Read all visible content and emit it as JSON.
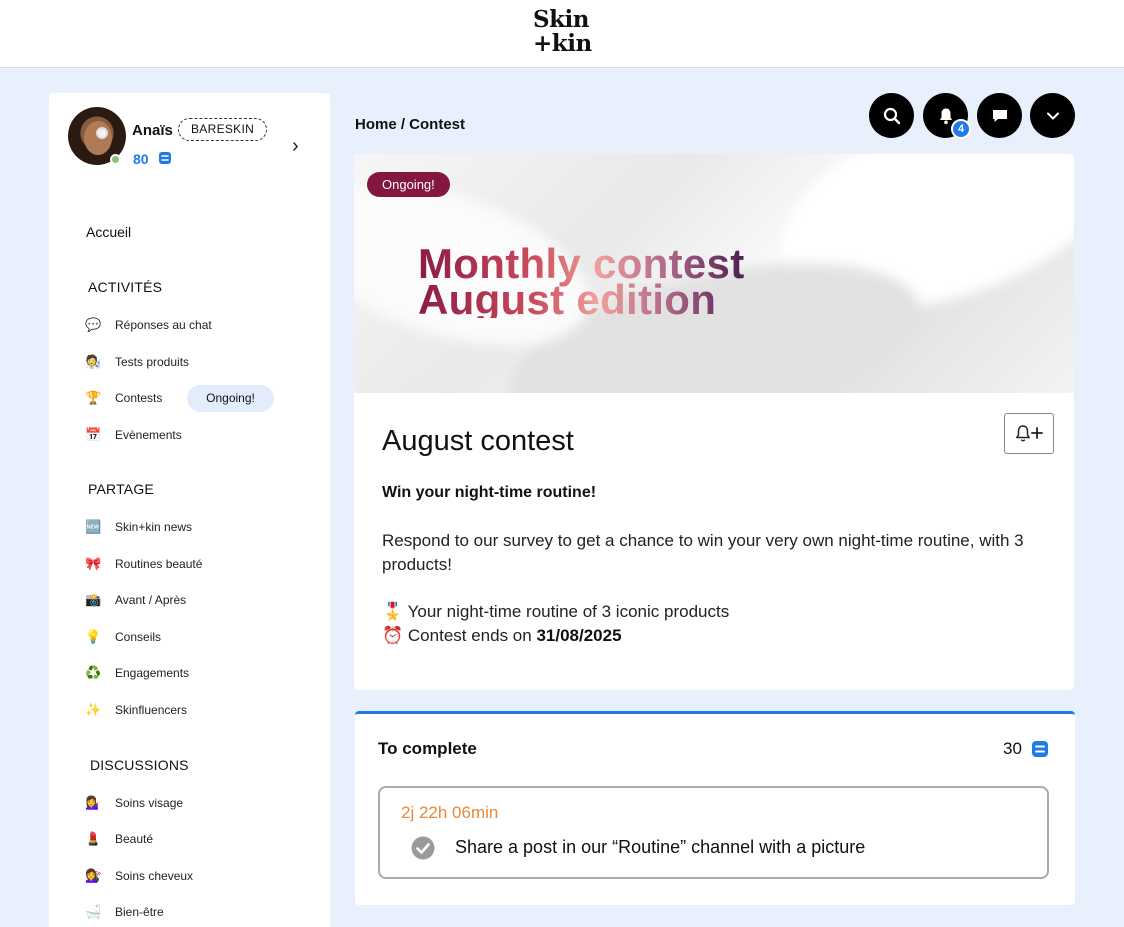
{
  "brand": {
    "logo_line1": "Skin",
    "logo_line2": "+kin"
  },
  "user": {
    "name": "Anaïs",
    "tier": "BARESKIN",
    "points": "80"
  },
  "nav": {
    "home": "Accueil",
    "sections": [
      {
        "title": "ACTIVITÉS",
        "items": [
          {
            "icon": "speech-bubble-icon",
            "glyph": "💬",
            "label": "Réponses au chat"
          },
          {
            "icon": "scientist-icon",
            "glyph": "🧑‍🔬",
            "label": "Tests produits"
          },
          {
            "icon": "trophy-icon",
            "glyph": "🏆",
            "label": "Contests",
            "badge": "Ongoing!"
          },
          {
            "icon": "calendar-icon",
            "glyph": "📅",
            "label": "Evènements"
          }
        ]
      },
      {
        "title": "PARTAGE",
        "items": [
          {
            "icon": "new-icon",
            "glyph": "🆕",
            "label": "Skin+kin news"
          },
          {
            "icon": "ribbon-icon",
            "glyph": "🎀",
            "label": "Routines beauté"
          },
          {
            "icon": "camera-icon",
            "glyph": "📸",
            "label": "Avant / Après"
          },
          {
            "icon": "lightbulb-icon",
            "glyph": "💡",
            "label": "Conseils"
          },
          {
            "icon": "recycle-icon",
            "glyph": "♻️",
            "label": "Engagements"
          },
          {
            "icon": "sparkles-icon",
            "glyph": "✨",
            "label": "Skinfluencers"
          }
        ]
      },
      {
        "title": "DISCUSSIONS",
        "items": [
          {
            "icon": "woman-tipping-hand-icon",
            "glyph": "💁‍♀️",
            "label": "Soins visage"
          },
          {
            "icon": "lipstick-icon",
            "glyph": "💄",
            "label": "Beauté"
          },
          {
            "icon": "woman-haircut-icon",
            "glyph": "💇‍♀️",
            "label": "Soins cheveux"
          },
          {
            "icon": "bathtub-icon",
            "glyph": "🛁",
            "label": "Bien-être"
          }
        ]
      }
    ]
  },
  "header": {
    "breadcrumb": "Home / Contest",
    "notification_count": "4"
  },
  "contest": {
    "status_badge": "Ongoing!",
    "banner_line1": "Monthly contest",
    "banner_line2": "August edition",
    "title": "August contest",
    "subtitle": "Win your night-time routine!",
    "description": "Respond to our survey to get a chance to win your very own night-time routine, with 3 products!",
    "prize_glyph": "🎖️",
    "prize_text": "Your night-time routine of 3 iconic products",
    "deadline_glyph": "⏰",
    "deadline_prefix": "Contest ends on ",
    "deadline_date": "31/08/2025"
  },
  "task": {
    "heading": "To complete",
    "points": "30",
    "timer": "2j 22h 06min",
    "text": "Share a post in our “Routine” channel with a picture"
  },
  "colors": {
    "accent": "#1f7ae8",
    "badge": "#84163f",
    "timer": "#e8883a"
  }
}
